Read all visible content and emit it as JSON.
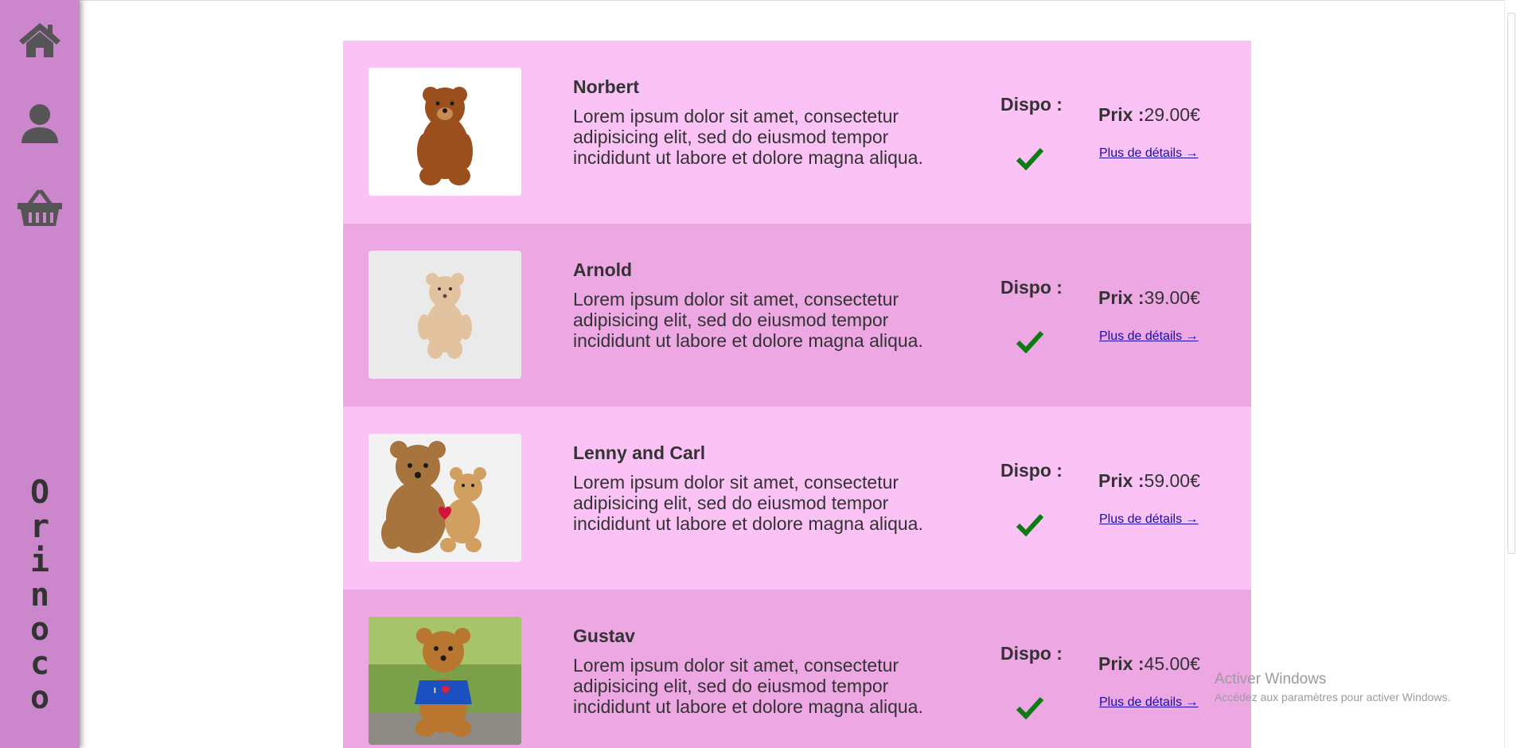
{
  "sidebar": {
    "brand_letters": [
      "O",
      "r",
      "i",
      "n",
      "o",
      "c",
      "o"
    ],
    "color": "#cc86cb",
    "icons": [
      "home-icon",
      "user-icon",
      "basket-icon"
    ]
  },
  "products": [
    {
      "name": "Norbert",
      "description": "Lorem ipsum dolor sit amet, consectetur adipisicing elit, sed do eiusmod tempor incididunt ut labore et dolore magna aliqua.",
      "dispo_label": "Dispo :",
      "price_label": "Prix :",
      "price_value": "29.00€",
      "details_link": "Plus de détails →"
    },
    {
      "name": "Arnold",
      "description": "Lorem ipsum dolor sit amet, consectetur adipisicing elit, sed do eiusmod tempor incididunt ut labore et dolore magna aliqua.",
      "dispo_label": "Dispo :",
      "price_label": "Prix :",
      "price_value": "39.00€",
      "details_link": "Plus de détails →"
    },
    {
      "name": "Lenny and Carl",
      "description": "Lorem ipsum dolor sit amet, consectetur adipisicing elit, sed do eiusmod tempor incididunt ut labore et dolore magna aliqua.",
      "dispo_label": "Dispo :",
      "price_label": "Prix :",
      "price_value": "59.00€",
      "details_link": "Plus de détails →"
    },
    {
      "name": "Gustav",
      "description": "Lorem ipsum dolor sit amet, consectetur adipisicing elit, sed do eiusmod tempor incididunt ut labore et dolore magna aliqua.",
      "dispo_label": "Dispo :",
      "price_label": "Prix :",
      "price_value": "45.00€",
      "details_link": "Plus de détails →"
    }
  ],
  "colors": {
    "card": "#fbc2f6",
    "card_alt": "#eda7e3",
    "available_check": "#0a7d12",
    "link": "#1a0dab"
  },
  "watermark": {
    "title": "Activer Windows",
    "subtitle": "Accédez aux paramètres pour activer Windows."
  }
}
